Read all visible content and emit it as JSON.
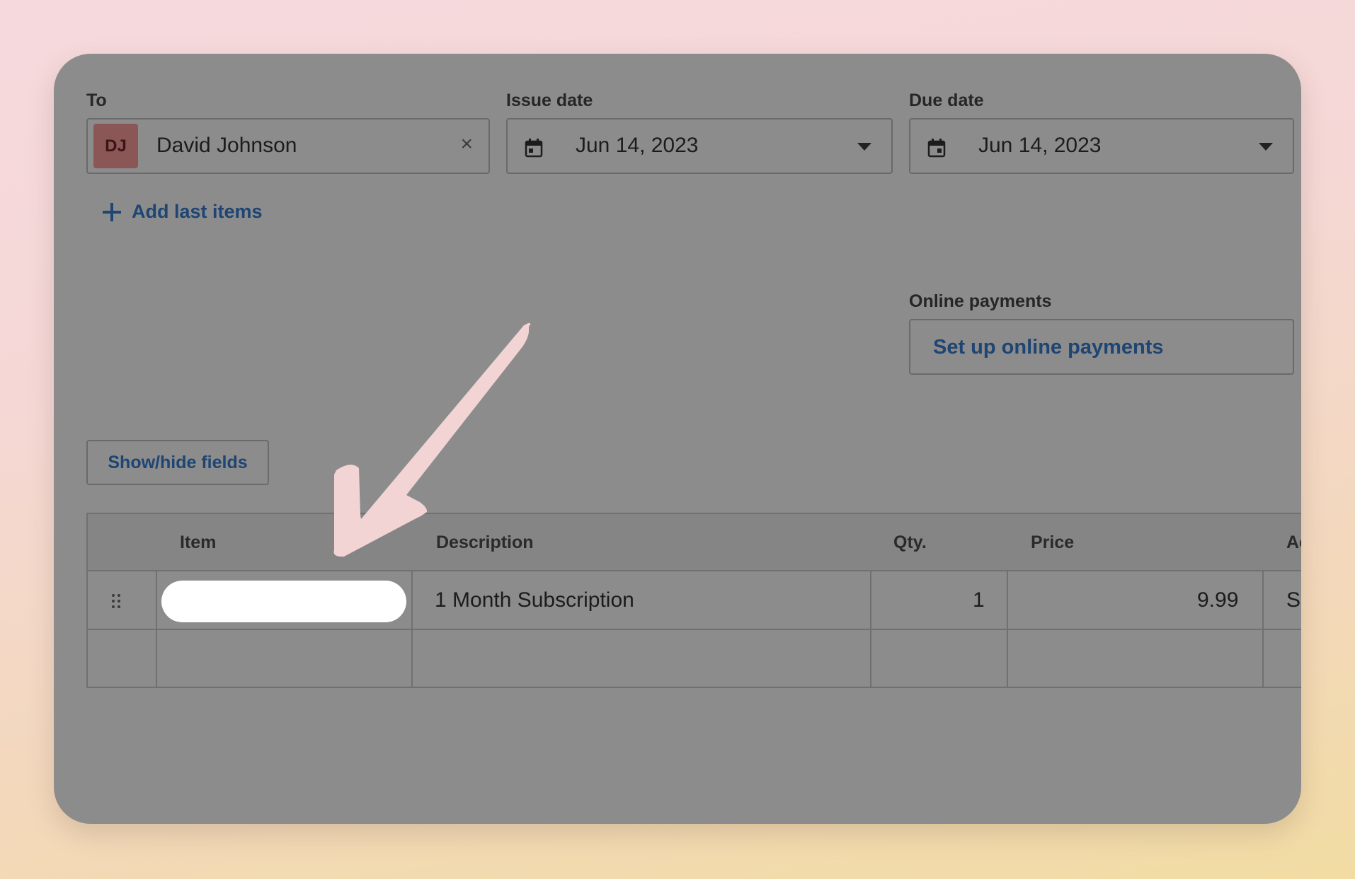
{
  "to": {
    "label": "To",
    "avatar_initials": "DJ",
    "name": "David Johnson",
    "clear_icon": "×",
    "avatar_color": "#8a5656"
  },
  "issue_date": {
    "label": "Issue date",
    "value": "Jun 14, 2023",
    "icon": "calendar-icon"
  },
  "due_date": {
    "label": "Due date",
    "value": "Jun 14, 2023",
    "icon": "calendar-icon"
  },
  "add_last_items": {
    "icon": "plus-icon",
    "label": "Add last items"
  },
  "online_payments": {
    "label": "Online payments",
    "button_label": "Set up online payments"
  },
  "show_hide_label": "Show/hide fields",
  "table": {
    "columns": [
      "Item",
      "Description",
      "Qty.",
      "Price",
      "Ac"
    ],
    "rows": [
      {
        "item": "",
        "description": "1 Month Subscription",
        "qty": "1",
        "price": "9.99",
        "amount": "S"
      }
    ]
  },
  "colors": {
    "link": "#1e4573",
    "overlay": "#8c8c8c",
    "arrow": "#f2d4d4"
  }
}
